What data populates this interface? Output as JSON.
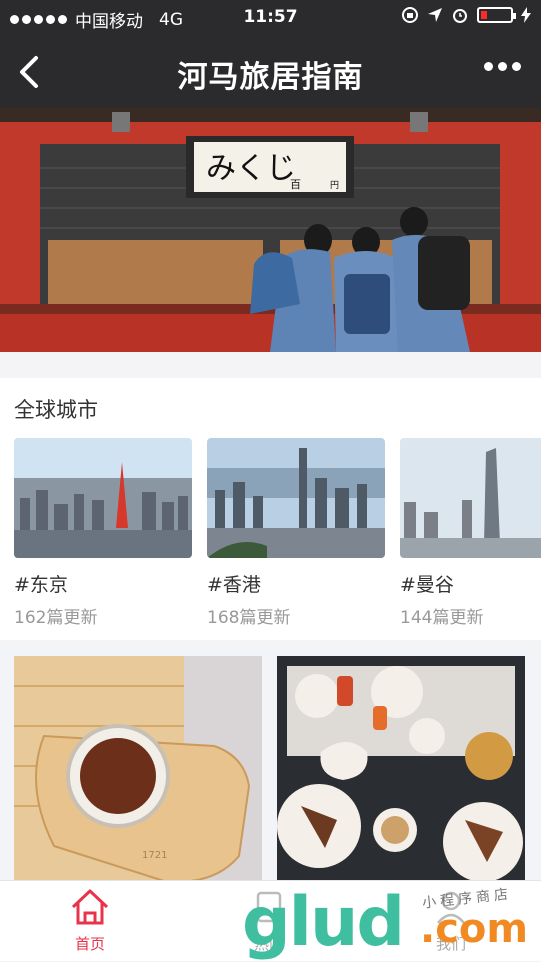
{
  "status_bar": {
    "carrier": "中国移动",
    "network": "4G",
    "time": "11:57"
  },
  "nav": {
    "title": "河马旅居指南"
  },
  "section": {
    "title": "全球城市",
    "cities": [
      {
        "name": "#东京",
        "updates": "162篇更新"
      },
      {
        "name": "#香港",
        "updates": "168篇更新"
      },
      {
        "name": "#曼谷",
        "updates": "144篇更新"
      }
    ]
  },
  "hero": {
    "sign_main": "みくじ",
    "sign_small_1": "百",
    "sign_small_2": "円"
  },
  "cards": {
    "cup_marking": "1721"
  },
  "tabs": [
    {
      "label": "首页",
      "active": true
    },
    {
      "label": "热门",
      "active": false
    },
    {
      "label": "我们",
      "active": false
    }
  ],
  "watermark": {
    "logo": "glud",
    "tld": ".com",
    "caption": "小程序商店"
  },
  "colors": {
    "accent": "#e8344b",
    "nav_bg": "#2b2b2d"
  }
}
